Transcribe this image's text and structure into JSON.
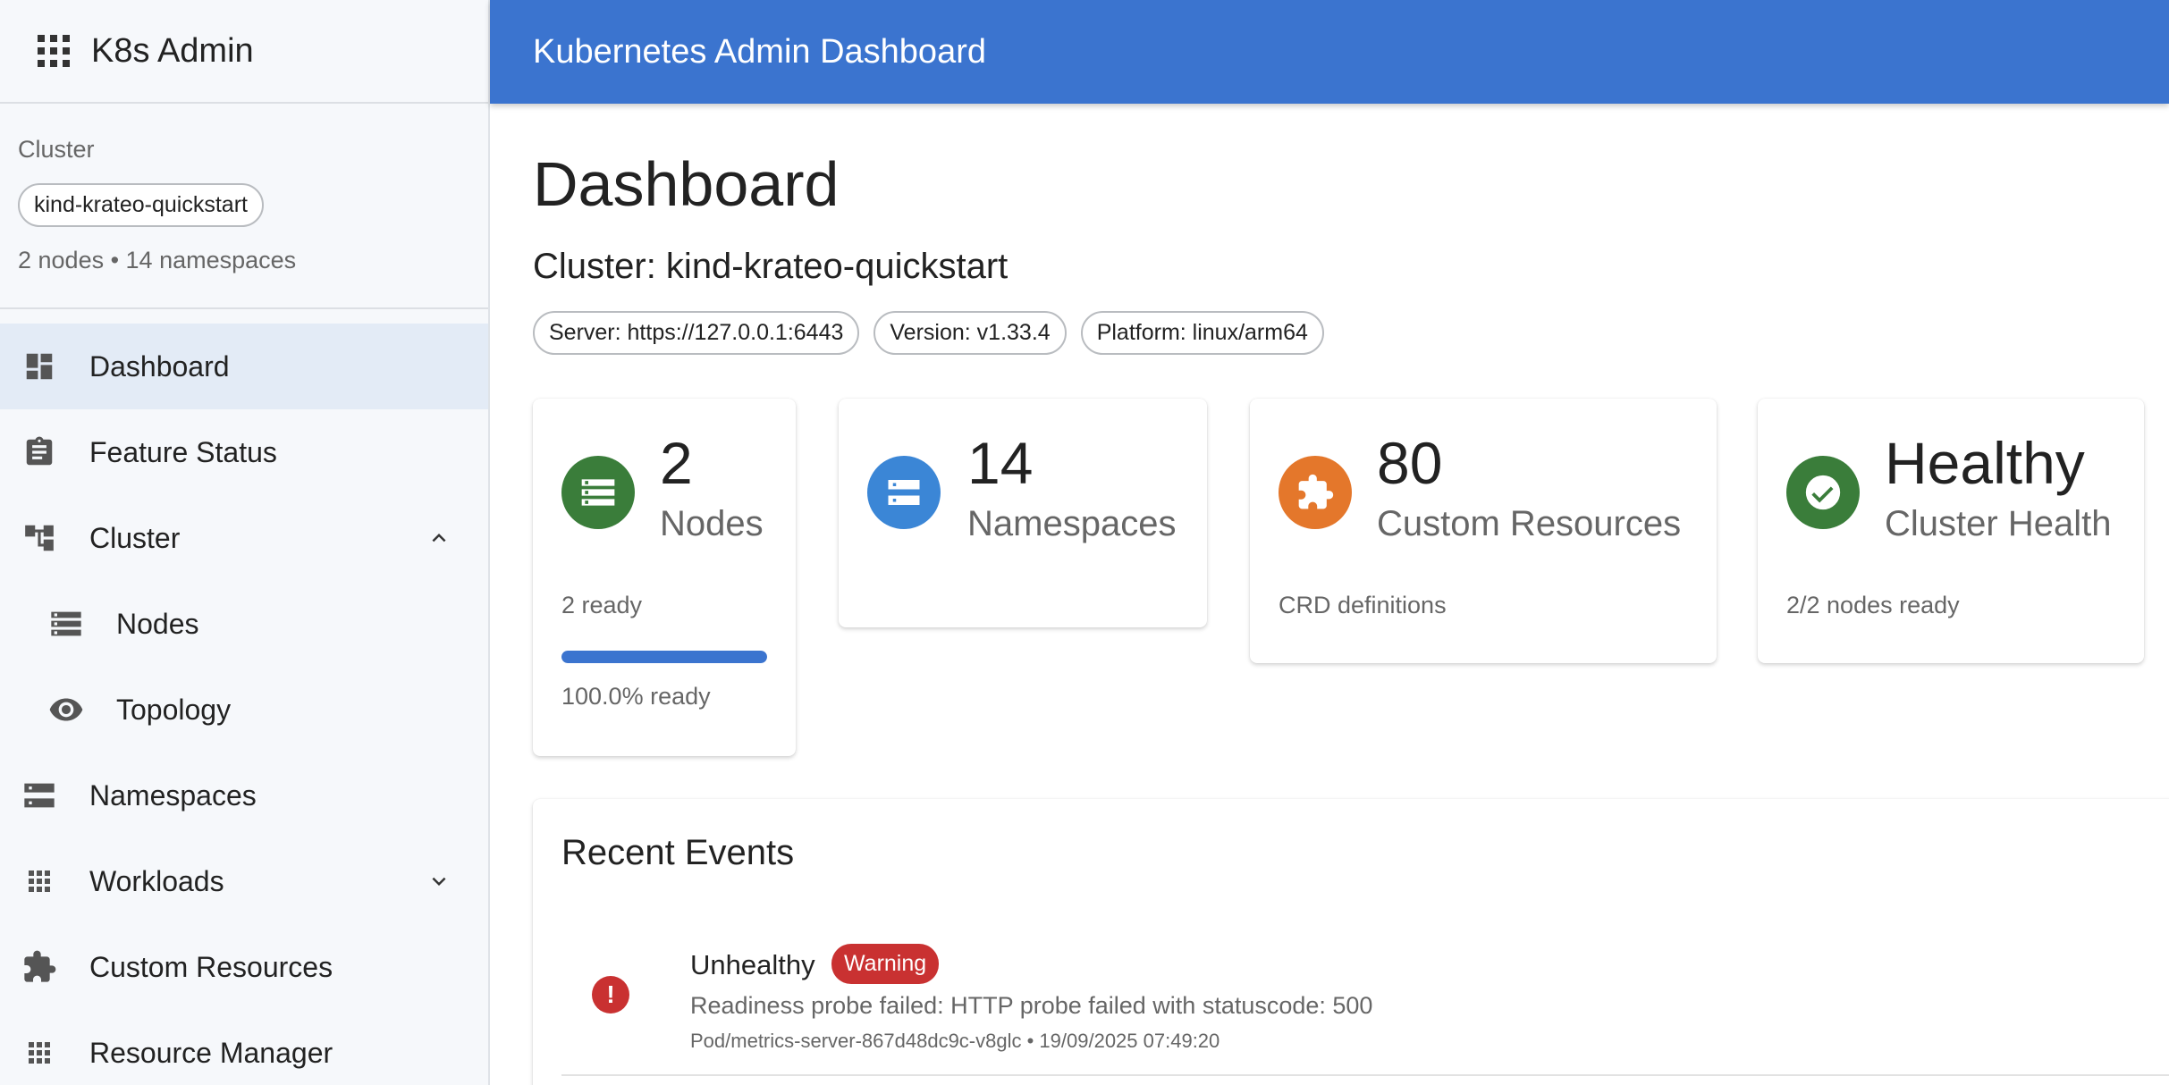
{
  "sidebar": {
    "brand_title": "K8s Admin",
    "cluster_label": "Cluster",
    "cluster_name": "kind-krateo-quickstart",
    "cluster_meta": "2 nodes • 14 namespaces",
    "items": [
      {
        "label": "Dashboard",
        "icon": "dashboard-icon",
        "active": true
      },
      {
        "label": "Feature Status",
        "icon": "clipboard-icon"
      },
      {
        "label": "Cluster",
        "icon": "hierarchy-icon",
        "expanded": true
      },
      {
        "label": "Nodes",
        "icon": "list-icon"
      },
      {
        "label": "Topology",
        "icon": "eye-icon"
      },
      {
        "label": "Namespaces",
        "icon": "storage-icon"
      },
      {
        "label": "Workloads",
        "icon": "apps-icon",
        "expanded": false
      },
      {
        "label": "Custom Resources",
        "icon": "puzzle-icon"
      },
      {
        "label": "Resource Manager",
        "icon": "apps-icon"
      }
    ]
  },
  "header": {
    "title": "Kubernetes Admin Dashboard"
  },
  "main": {
    "page_title": "Dashboard",
    "cluster_heading": "Cluster: kind-krateo-quickstart",
    "badges": [
      "Server: https://127.0.0.1:6443",
      "Version: v1.33.4",
      "Platform: linux/arm64"
    ],
    "cards": {
      "nodes": {
        "value": "2",
        "label": "Nodes",
        "caption": "2 ready",
        "progress_fraction": 1.0,
        "percent_text": "100.0% ready",
        "color": "#3a7d3a",
        "icon": "list-icon"
      },
      "namespaces": {
        "value": "14",
        "label": "Namespaces",
        "color": "#3b86d6",
        "icon": "storage-icon"
      },
      "custom_resources": {
        "value": "80",
        "label": "Custom Resources",
        "caption": "CRD definitions",
        "color": "#e4772b",
        "icon": "puzzle-icon"
      },
      "health": {
        "value": "Healthy",
        "label": "Cluster Health",
        "caption": "2/2 nodes ready",
        "color": "#3a7d3a",
        "icon": "check-circle-icon"
      }
    },
    "events": {
      "heading": "Recent Events",
      "items": [
        {
          "reason": "Unhealthy",
          "type": "Warning",
          "message": "Readiness probe failed: HTTP probe failed with statuscode: 500",
          "source": "Pod/metrics-server-867d48dc9c-v8glc • 19/09/2025 07:49:20",
          "icon": "error-icon",
          "color": "#c93131"
        }
      ]
    }
  }
}
